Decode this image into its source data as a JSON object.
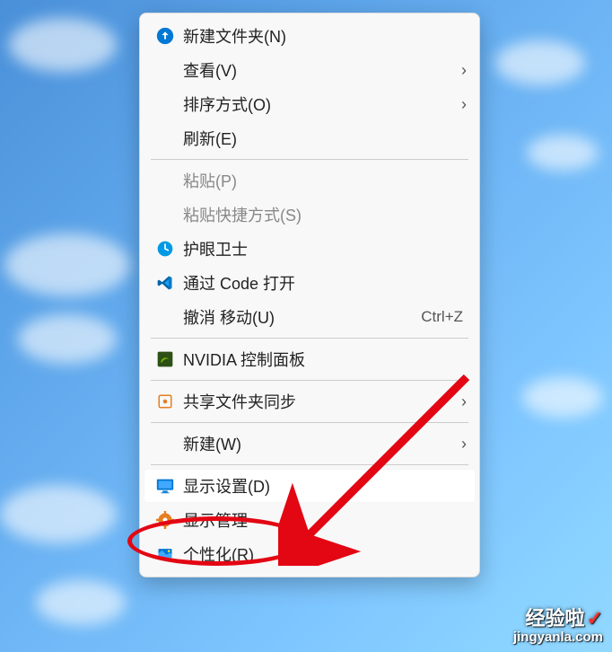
{
  "menu": {
    "items": [
      {
        "icon": "folder-new",
        "label": "新建文件夹(N)",
        "hasSubmenu": false
      },
      {
        "icon": "",
        "label": "查看(V)",
        "hasSubmenu": true
      },
      {
        "icon": "",
        "label": "排序方式(O)",
        "hasSubmenu": true
      },
      {
        "icon": "",
        "label": "刷新(E)",
        "hasSubmenu": false
      }
    ],
    "group2": [
      {
        "icon": "",
        "label": "粘贴(P)",
        "disabled": true
      },
      {
        "icon": "",
        "label": "粘贴快捷方式(S)",
        "disabled": true
      },
      {
        "icon": "eye-guard",
        "label": "护眼卫士"
      },
      {
        "icon": "vscode",
        "label": "通过 Code 打开"
      },
      {
        "icon": "",
        "label": "撤消 移动(U)",
        "shortcut": "Ctrl+Z"
      }
    ],
    "group3": [
      {
        "icon": "nvidia",
        "label": "NVIDIA 控制面板"
      }
    ],
    "group4": [
      {
        "icon": "share",
        "label": "共享文件夹同步",
        "hasSubmenu": true
      }
    ],
    "group5": [
      {
        "icon": "",
        "label": "新建(W)",
        "hasSubmenu": true
      }
    ],
    "group6": [
      {
        "icon": "monitor",
        "label": "显示设置(D)",
        "highlighted": true
      },
      {
        "icon": "display-mgr",
        "label": "显示管理"
      },
      {
        "icon": "personalize",
        "label": "个性化(R)"
      }
    ]
  },
  "watermark": {
    "title": "经验啦",
    "check": "✓",
    "url": "jingyanla.com"
  }
}
